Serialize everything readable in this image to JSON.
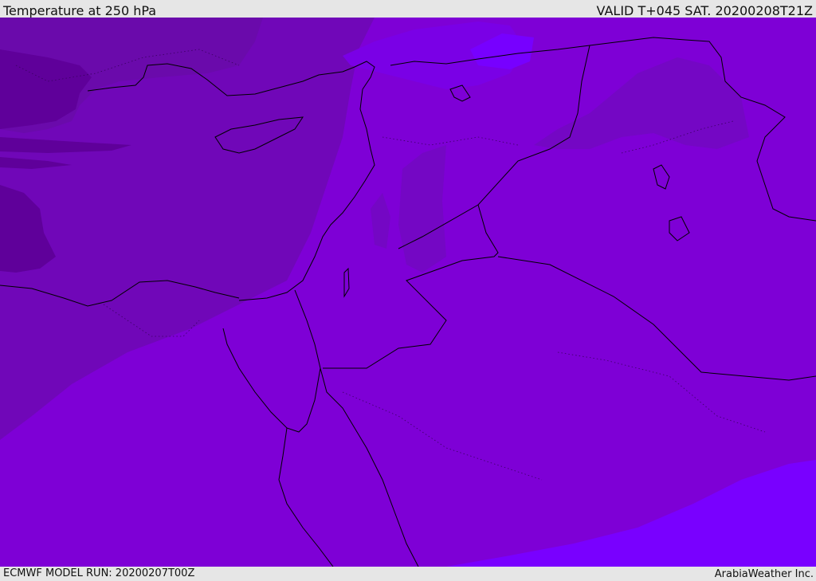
{
  "header": {
    "title": "Temperature at 250 hPa",
    "valid": "VALID T+045 SAT. 20200208T21Z"
  },
  "footer": {
    "model_run": "ECMWF MODEL RUN: 20200207T00Z",
    "credit": "ArabiaWeather Inc."
  },
  "map": {
    "field": "Temperature",
    "level": "250 hPa",
    "palette": {
      "dark_purple": "#60009b",
      "medium_purple": "#6f0db0",
      "base_purple": "#7e00d6",
      "light_purple": "#7900ff",
      "mid_violet": "#7405c4",
      "coast_color": "#000000"
    }
  }
}
